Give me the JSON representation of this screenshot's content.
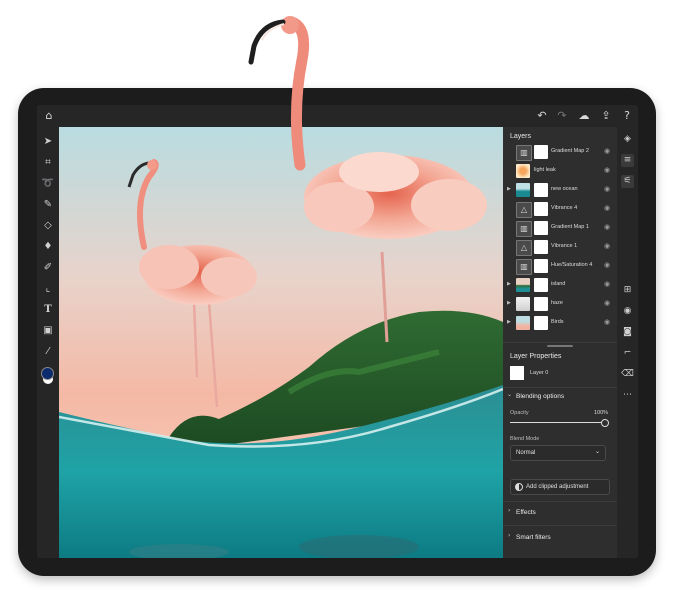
{
  "panel": {
    "layers_title": "Layers",
    "layers": [
      {
        "name": "Gradient Map 2",
        "thumb": "adjust",
        "expand": false
      },
      {
        "name": "light leak",
        "thumb": "sun",
        "expand": false
      },
      {
        "name": "new ocean",
        "thumb": "ocean",
        "expand": true
      },
      {
        "name": "Vibrance 4",
        "thumb": "triangle",
        "expand": false
      },
      {
        "name": "Gradient Map 1",
        "thumb": "adjust",
        "expand": false
      },
      {
        "name": "Vibrance 1",
        "thumb": "triangle",
        "expand": false
      },
      {
        "name": "Hue/Saturation 4",
        "thumb": "adjust",
        "expand": false
      },
      {
        "name": "island",
        "thumb": "island",
        "expand": true
      },
      {
        "name": "haze",
        "thumb": "haze",
        "expand": true
      },
      {
        "name": "Birds",
        "thumb": "birds",
        "expand": true
      }
    ],
    "layer_properties_title": "Layer Properties",
    "layer_name": "Layer 0",
    "blending_title": "Blending options",
    "opacity_label": "Opacity",
    "opacity_value": "100%",
    "opacity_level": 1.0,
    "blend_mode_label": "Blend Mode",
    "blend_mode_value": "Normal",
    "add_clipped_label": "Add clipped adjustment",
    "effects_label": "Effects",
    "smart_filters_label": "Smart filters"
  },
  "icons": {
    "home": "home-icon",
    "undo": "undo-icon",
    "redo": "redo-icon",
    "cloud": "cloud-icon",
    "share": "share-icon",
    "help": "help-icon"
  },
  "colors": {
    "foreground": "#0d2c6e",
    "background": "#ffffff",
    "accent": "#ffffff"
  }
}
